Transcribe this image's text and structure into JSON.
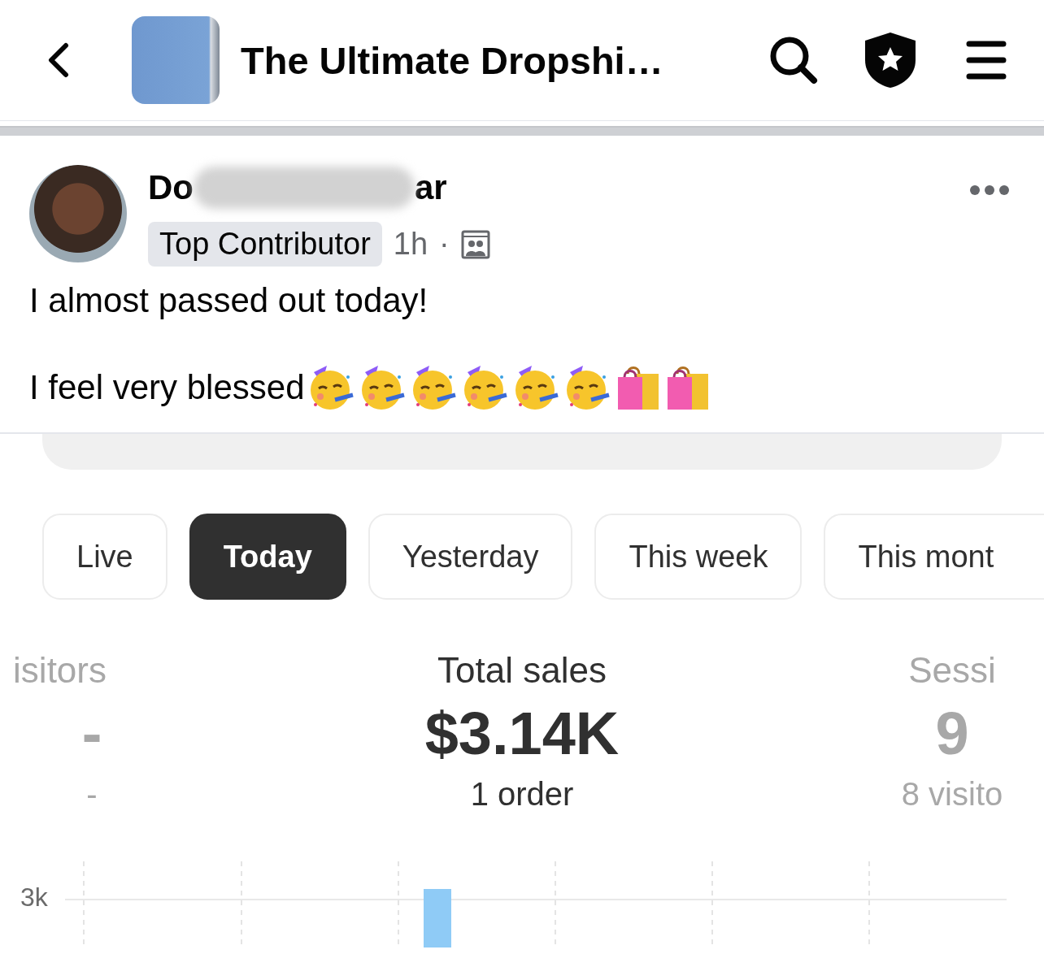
{
  "header": {
    "title": "The Ultimate Dropshi…"
  },
  "post": {
    "author_parts": [
      "Do",
      "ar"
    ],
    "badge": "Top Contributor",
    "time": "1h",
    "separator": "·",
    "lines": [
      "I almost passed out today!",
      "I feel very blessed"
    ],
    "emojis": [
      {
        "kind": "partying-face"
      },
      {
        "kind": "partying-face"
      },
      {
        "kind": "partying-face"
      },
      {
        "kind": "partying-face"
      },
      {
        "kind": "partying-face"
      },
      {
        "kind": "partying-face"
      },
      {
        "kind": "shopping-bags"
      },
      {
        "kind": "shopping-bags"
      }
    ]
  },
  "embedded_screenshot": {
    "tabs": [
      {
        "label": "Live",
        "selected": false
      },
      {
        "label": "Today",
        "selected": true
      },
      {
        "label": "Yesterday",
        "selected": false
      },
      {
        "label": "This week",
        "selected": false
      },
      {
        "label": "This mont",
        "selected": false
      }
    ],
    "metrics": [
      {
        "label": "isitors",
        "value": "-",
        "detail": "-",
        "dimmed": true
      },
      {
        "label": "Total sales",
        "value": "$3.14K",
        "detail": "1 order",
        "dimmed": false
      },
      {
        "label": "Sessi",
        "value": "9",
        "detail": "8 visito",
        "dimmed": true
      }
    ],
    "chart": {
      "tick_label": "3k"
    }
  }
}
